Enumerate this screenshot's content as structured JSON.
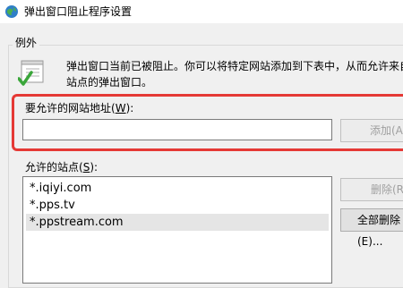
{
  "window": {
    "title": "弹出窗口阻止程序设置",
    "icon": "globe-shield-icon"
  },
  "exceptions": {
    "group_label": "例外",
    "info_icon": "checklist-icon",
    "description_line1": "弹出窗口当前已被阻止。你可以将特定网站添加到下表中，从而允许来自",
    "description_line2": "站点的弹出窗口。"
  },
  "address": {
    "label_prefix": "要允许的网站地址(",
    "label_key": "W",
    "label_suffix": "):",
    "value": "",
    "add_button": "添加(A)",
    "highlight_color": "#e53935"
  },
  "allowed_sites": {
    "label_prefix": "允许的站点(",
    "label_key": "S",
    "label_suffix": "):",
    "items": [
      "*.iqiyi.com",
      "*.pps.tv",
      "*.ppstream.com"
    ],
    "selected_index": 2,
    "remove_button": "删除(R)",
    "remove_all_button": "全部删除(E)..."
  }
}
